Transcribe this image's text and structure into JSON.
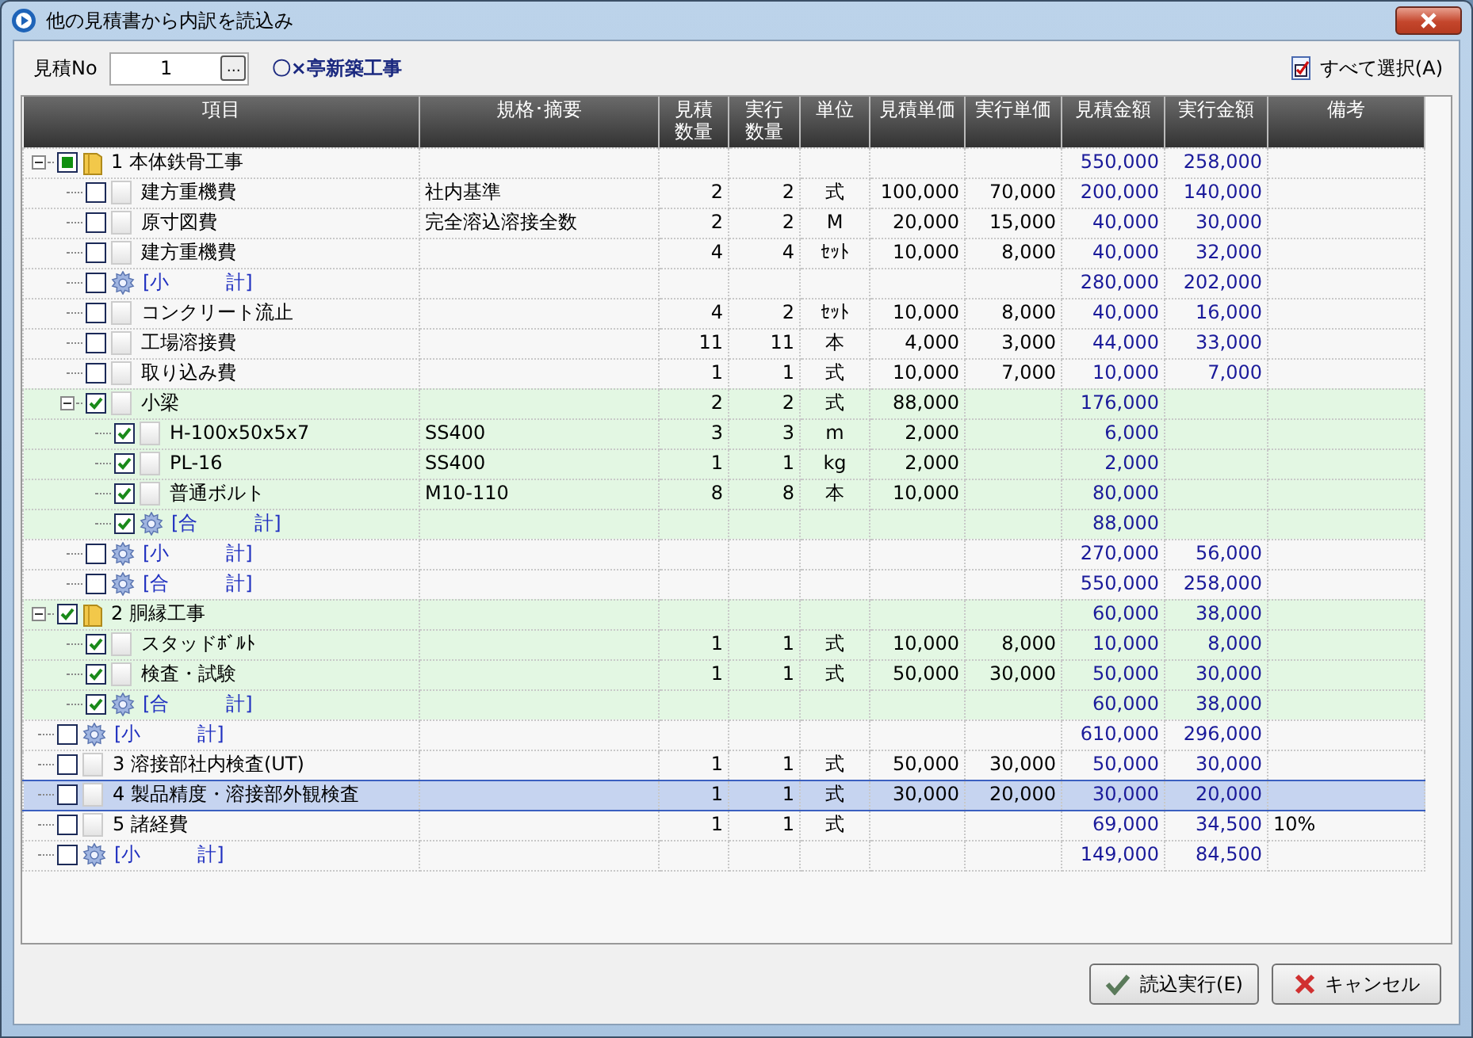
{
  "window": {
    "title": "他の見積書から内訳を読込み"
  },
  "toolbar": {
    "estimate_label": "見積No",
    "estimate_no": "1",
    "browse_button": "…",
    "project_name": "〇×亭新築工事",
    "select_all": "すべて選択(A)"
  },
  "table": {
    "columns": [
      "項目",
      "規格･摘要",
      "見積数量",
      "実行数量",
      "単位",
      "見積単価",
      "実行単価",
      "見積金額",
      "実行金額",
      "備考"
    ],
    "rows": [
      {
        "kind": "group",
        "name": "1 本体鉄骨工事",
        "expanded": true,
        "checked": false,
        "partial": true,
        "selected": false,
        "est_amount": "550,000",
        "exec_amount": "258,000",
        "children": [
          {
            "kind": "item",
            "name": "建方重機費",
            "checked": false,
            "selected": false,
            "spec": "社内基準",
            "est_qty": "2",
            "exec_qty": "2",
            "unit": "式",
            "est_price": "100,000",
            "exec_price": "70,000",
            "est_amount": "200,000",
            "exec_amount": "140,000"
          },
          {
            "kind": "item",
            "name": "原寸図費",
            "checked": false,
            "selected": false,
            "spec": "完全溶込溶接全数",
            "est_qty": "2",
            "exec_qty": "2",
            "unit": "M",
            "est_price": "20,000",
            "exec_price": "15,000",
            "est_amount": "40,000",
            "exec_amount": "30,000"
          },
          {
            "kind": "item",
            "name": "建方重機費",
            "checked": false,
            "selected": false,
            "est_qty": "4",
            "exec_qty": "4",
            "unit": "ｾｯﾄ",
            "est_price": "10,000",
            "exec_price": "8,000",
            "est_amount": "40,000",
            "exec_amount": "32,000"
          },
          {
            "kind": "subtotal",
            "name": "[小　　　計]",
            "checked": false,
            "selected": false,
            "est_amount": "280,000",
            "exec_amount": "202,000"
          },
          {
            "kind": "item",
            "name": "コンクリート流止",
            "checked": false,
            "selected": false,
            "est_qty": "4",
            "exec_qty": "2",
            "unit": "ｾｯﾄ",
            "est_price": "10,000",
            "exec_price": "8,000",
            "est_amount": "40,000",
            "exec_amount": "16,000"
          },
          {
            "kind": "item",
            "name": "工場溶接費",
            "checked": false,
            "selected": false,
            "est_qty": "11",
            "exec_qty": "11",
            "unit": "本",
            "est_price": "4,000",
            "exec_price": "3,000",
            "est_amount": "44,000",
            "exec_amount": "33,000"
          },
          {
            "kind": "item",
            "name": "取り込み費",
            "checked": false,
            "selected": false,
            "est_qty": "1",
            "exec_qty": "1",
            "unit": "式",
            "est_price": "10,000",
            "exec_price": "7,000",
            "est_amount": "10,000",
            "exec_amount": "7,000"
          },
          {
            "kind": "item",
            "name": "小梁",
            "expanded": true,
            "checked": true,
            "selected": false,
            "est_qty": "2",
            "exec_qty": "2",
            "unit": "式",
            "est_price": "88,000",
            "est_amount": "176,000",
            "children": [
              {
                "kind": "item",
                "name": "H-100x50x5x7",
                "checked": true,
                "selected": false,
                "spec": "SS400",
                "est_qty": "3",
                "exec_qty": "3",
                "unit": "m",
                "est_price": "2,000",
                "est_amount": "6,000"
              },
              {
                "kind": "item",
                "name": "PL-16",
                "checked": true,
                "selected": false,
                "spec": "SS400",
                "est_qty": "1",
                "exec_qty": "1",
                "unit": "kg",
                "est_price": "2,000",
                "est_amount": "2,000"
              },
              {
                "kind": "item",
                "name": "普通ボルト",
                "checked": true,
                "selected": false,
                "spec": "M10-110",
                "est_qty": "8",
                "exec_qty": "8",
                "unit": "本",
                "est_price": "10,000",
                "est_amount": "80,000"
              },
              {
                "kind": "subtotal",
                "name": "[合　　　計]",
                "checked": true,
                "selected": false,
                "est_amount": "88,000"
              }
            ]
          },
          {
            "kind": "subtotal",
            "name": "[小　　　計]",
            "checked": false,
            "selected": false,
            "est_amount": "270,000",
            "exec_amount": "56,000"
          },
          {
            "kind": "subtotal",
            "name": "[合　　　計]",
            "checked": false,
            "selected": false,
            "est_amount": "550,000",
            "exec_amount": "258,000"
          }
        ]
      },
      {
        "kind": "group",
        "name": "2 胴縁工事",
        "expanded": true,
        "checked": true,
        "selected": false,
        "est_amount": "60,000",
        "exec_amount": "38,000",
        "children": [
          {
            "kind": "item",
            "name": "スタッドﾎﾞﾙﾄ",
            "checked": true,
            "selected": false,
            "est_qty": "1",
            "exec_qty": "1",
            "unit": "式",
            "est_price": "10,000",
            "exec_price": "8,000",
            "est_amount": "10,000",
            "exec_amount": "8,000"
          },
          {
            "kind": "item",
            "name": "検査・試験",
            "checked": true,
            "selected": false,
            "est_qty": "1",
            "exec_qty": "1",
            "unit": "式",
            "est_price": "50,000",
            "exec_price": "30,000",
            "est_amount": "50,000",
            "exec_amount": "30,000"
          },
          {
            "kind": "subtotal",
            "name": "[合　　　計]",
            "checked": true,
            "selected": false,
            "est_amount": "60,000",
            "exec_amount": "38,000"
          }
        ]
      },
      {
        "kind": "subtotal",
        "name": "[小　　　計]",
        "checked": false,
        "selected": false,
        "est_amount": "610,000",
        "exec_amount": "296,000"
      },
      {
        "kind": "item",
        "name": "3 溶接部社内検査(UT)",
        "checked": false,
        "selected": false,
        "est_qty": "1",
        "exec_qty": "1",
        "unit": "式",
        "est_price": "50,000",
        "exec_price": "30,000",
        "est_amount": "50,000",
        "exec_amount": "30,000"
      },
      {
        "kind": "item",
        "name": "4 製品精度・溶接部外観検査",
        "checked": false,
        "selected": true,
        "est_qty": "1",
        "exec_qty": "1",
        "unit": "式",
        "est_price": "30,000",
        "exec_price": "20,000",
        "est_amount": "30,000",
        "exec_amount": "20,000"
      },
      {
        "kind": "item",
        "name": "5 諸経費",
        "checked": false,
        "selected": false,
        "est_qty": "1",
        "exec_qty": "1",
        "unit": "式",
        "est_amount": "69,000",
        "exec_amount": "34,500",
        "note": "10%"
      },
      {
        "kind": "subtotal",
        "name": "[小　　　計]",
        "checked": false,
        "selected": false,
        "est_amount": "149,000",
        "exec_amount": "84,500"
      }
    ]
  },
  "buttons": [
    {
      "kind": "ok",
      "label": "読込実行(E)"
    },
    {
      "kind": "cancel",
      "label": "キャンセル"
    }
  ]
}
